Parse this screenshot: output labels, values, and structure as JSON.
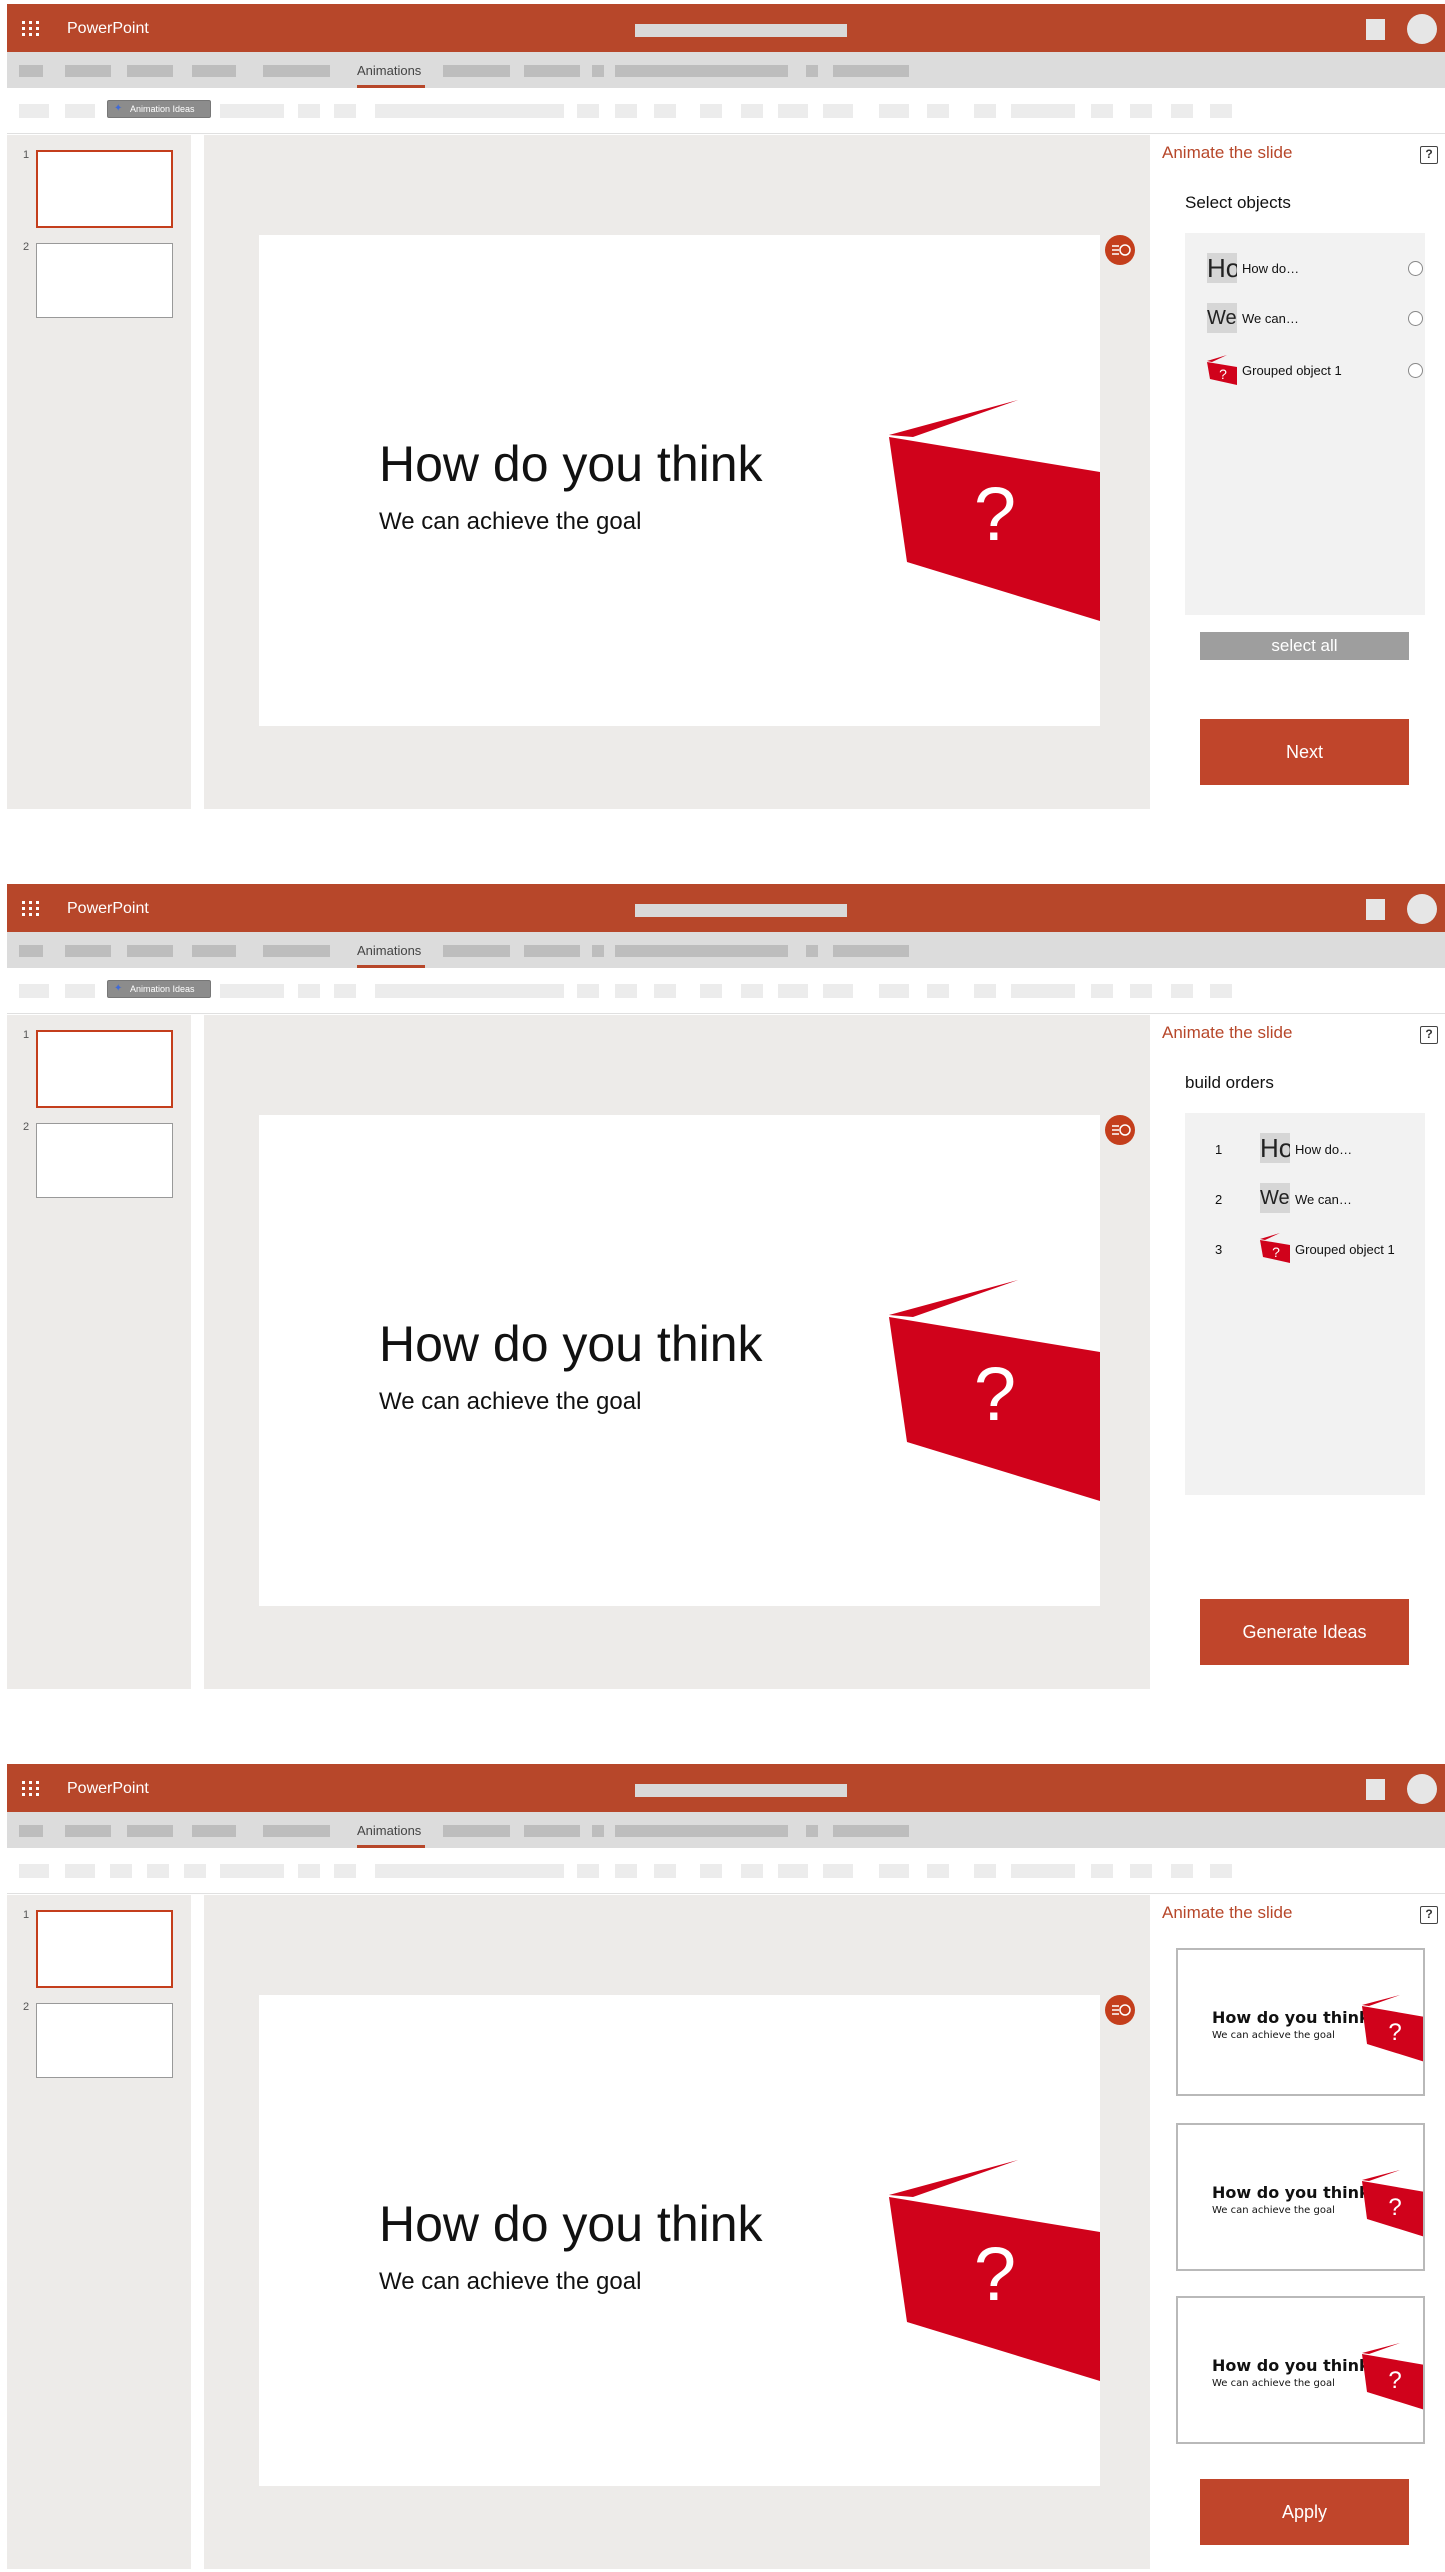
{
  "app": {
    "name": "PowerPoint"
  },
  "ribbon": {
    "active_tab": "Animations",
    "animation_ideas_button": "Animation Ideas"
  },
  "colors": {
    "brand": "#b7472a",
    "accent_red": "#d0021b",
    "panel_button": "#c0452b"
  },
  "slide": {
    "title": "How do you think",
    "subtitle": "We can achieve the goal",
    "graphic_symbol": "?"
  },
  "thumbnails": [
    {
      "number": "1",
      "selected": true
    },
    {
      "number": "2",
      "selected": false
    }
  ],
  "screens": [
    {
      "panel": {
        "title": "Animate the slide",
        "help_icon": "?",
        "section_title": "Select objects",
        "objects": [
          {
            "thumb_text": "Ho",
            "label": "How do…",
            "icon": "title-text-icon"
          },
          {
            "thumb_text": "We",
            "label": "We can…",
            "icon": "subtitle-text-icon"
          },
          {
            "thumb_text": "?",
            "label": "Grouped object 1",
            "icon": "grouped-object-icon"
          }
        ],
        "select_all_label": "select all",
        "primary_button": "Next"
      }
    },
    {
      "panel": {
        "title": "Animate the slide",
        "help_icon": "?",
        "section_title": "build orders",
        "orders": [
          {
            "number": "1",
            "thumb_text": "Ho",
            "label": "How do…"
          },
          {
            "number": "2",
            "thumb_text": "We",
            "label": "We can…"
          },
          {
            "number": "3",
            "thumb_text": "?",
            "label": "Grouped object 1"
          }
        ],
        "primary_button": "Generate Ideas"
      }
    },
    {
      "panel": {
        "title": "Animate the slide",
        "help_icon": "?",
        "ideas": [
          {
            "title": "How do you think",
            "subtitle": "We can achieve the goal",
            "symbol": "?"
          },
          {
            "title": "How do you think",
            "subtitle": "We can achieve the goal",
            "symbol": "?"
          },
          {
            "title": "How do you think",
            "subtitle": "We can achieve the goal",
            "symbol": "?"
          }
        ],
        "primary_button": "Apply"
      }
    }
  ]
}
